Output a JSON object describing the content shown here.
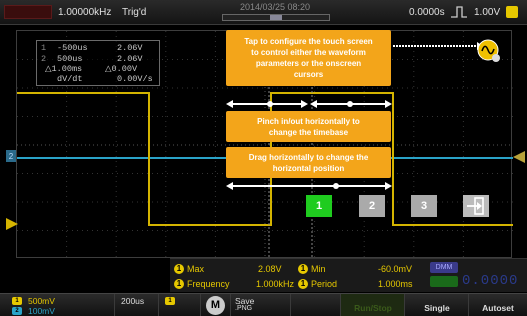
{
  "topbar": {
    "sample_rate": "1.00000kHz",
    "trigger_status": "Trig'd",
    "date": "2014/03/25  08:20",
    "memory_view_fraction": 0.12,
    "trigger_position": "0.0000s",
    "trigger_level": "1.00V",
    "icons": [
      "rising-edge-icon"
    ],
    "accent": "#e6c800"
  },
  "cursors": {
    "rows": [
      {
        "key": "1",
        "a": "-500us",
        "b": "2.06V"
      },
      {
        "key": "2",
        "a": "500us",
        "b": "2.06V"
      },
      {
        "key": "",
        "a": "△1.00ms",
        "b": "△0.00V"
      },
      {
        "key": "",
        "a": "dV/dt",
        "b": "0.00V/s"
      }
    ]
  },
  "hints": {
    "touch": [
      "Tap to configure the touch screen",
      "to control either the waveform",
      "parameters or the onscreen",
      "cursors"
    ],
    "pinch": [
      "Pinch in/out horizontally to",
      "change the timebase"
    ],
    "drag": [
      "Drag horizontally to change the",
      "horizontal position"
    ],
    "color": "#f3a51a"
  },
  "buttons": {
    "b1": "1",
    "b2": "2",
    "b3": "3",
    "active_color": "#1fcc1f"
  },
  "measurements": {
    "items": [
      {
        "index": "1",
        "label": "Max",
        "value": "2.08V"
      },
      {
        "index": "1",
        "label": "Min",
        "value": "-60.0mV"
      },
      {
        "index": "1",
        "label": "Frequency",
        "value": "1.000kHz"
      },
      {
        "index": "1",
        "label": "Period",
        "value": "1.000ms"
      }
    ],
    "dmm_tag": "DMM",
    "dmm_value": "0.0000"
  },
  "bottombar": {
    "ch1_scale": "500mV",
    "ch2_scale": "100mV",
    "timebase": "200us",
    "math_label": "M",
    "save_label": "Save",
    "save_format": ".PNG",
    "run_stop": "Run/Stop",
    "single": "Single",
    "autoset": "Autoset"
  }
}
